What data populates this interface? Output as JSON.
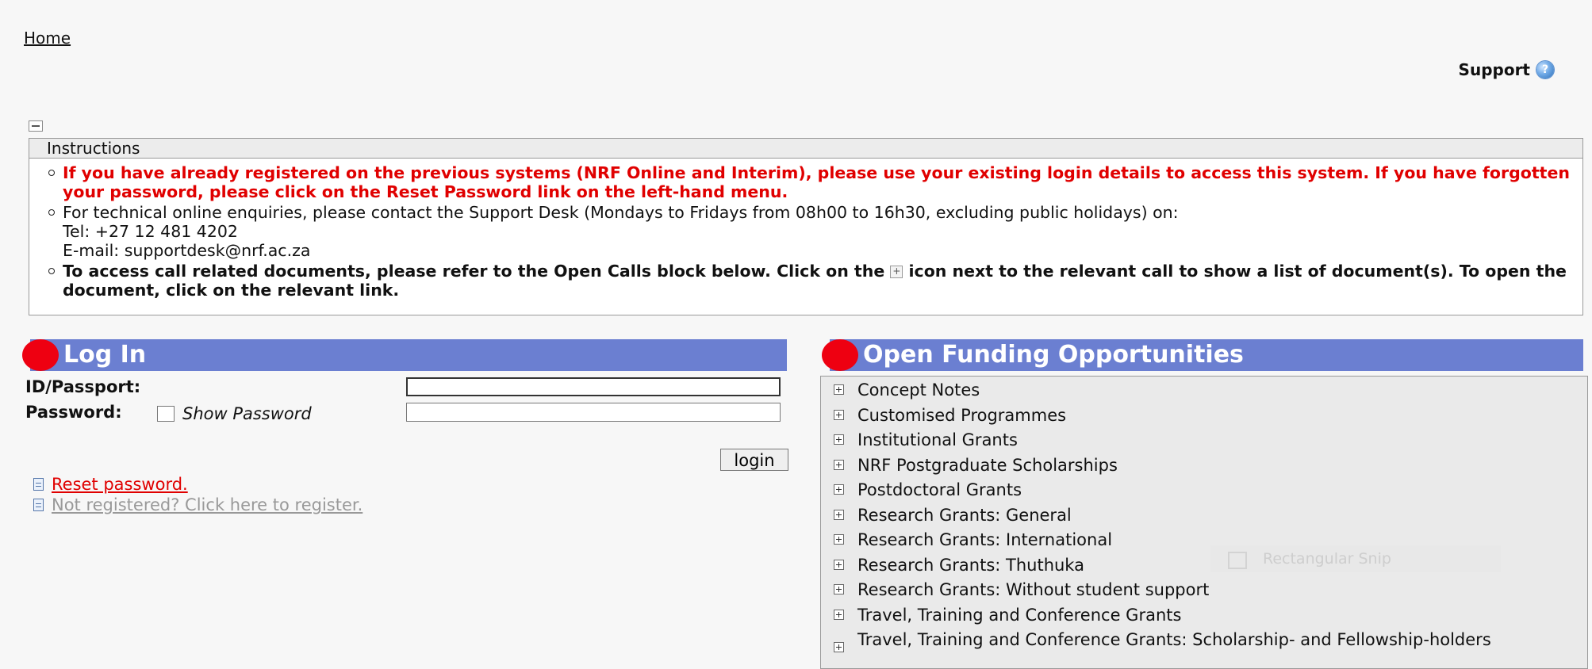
{
  "nav": {
    "home_label": "Home"
  },
  "support": {
    "label": "Support",
    "icon": "help-icon"
  },
  "instructions": {
    "header": "Instructions",
    "item1": "If you have already registered on the previous systems (NRF Online and Interim), please use your existing login details to access this system. If you have forgotten your password, please click on the Reset Password link on the left-hand menu.",
    "item2_line1": "For technical online enquiries, please contact the Support Desk (Mondays to Fridays from 08h00 to 16h30, excluding public holidays) on:",
    "item2_line2": "Tel: +27 12 481 4202",
    "item2_line3": "E-mail: supportdesk@nrf.ac.za",
    "item3_part1": "To access call related documents, please refer to the Open Calls block below. Click on the",
    "item3_icon_glyph": "+",
    "item3_part2": "icon next to the relevant call to show a list of document(s). To open the document, click on the relevant link.",
    "colors": {
      "highlight": "#e00000"
    }
  },
  "login": {
    "title": "Log In",
    "id_label": "ID/Passport:",
    "password_label": "Password:",
    "show_password_label": "Show Password",
    "button_label": "login",
    "reset_link": "Reset password.",
    "register_link": "Not registered? Click here to register."
  },
  "funding": {
    "title": "Open Funding Opportunities",
    "items": [
      "Concept Notes",
      "Customised Programmes",
      "Institutional Grants",
      "NRF Postgraduate Scholarships",
      "Postdoctoral Grants",
      "Research Grants: General",
      "Research Grants: International",
      "Research Grants: Thuthuka",
      "Research Grants: Without student support",
      "Travel, Training and Conference Grants",
      "Travel, Training and Conference Grants: Scholarship- and Fellowship-holders"
    ]
  },
  "overlay": {
    "snip_label": "Rectangular Snip"
  },
  "theme": {
    "header_blue": "#6b7fd1",
    "bullet_red": "#ee0011"
  }
}
